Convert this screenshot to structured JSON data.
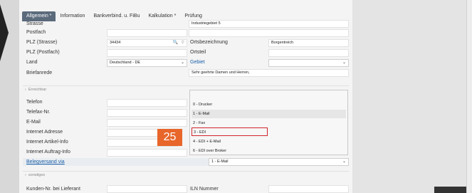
{
  "tabs": [
    "Allgemein *",
    "Information",
    "Bankverbind. u. FiBu",
    "Kalkulation *",
    "Prüfung"
  ],
  "labels": {
    "strasse": "Strasse",
    "postfach": "Postfach",
    "plz_strasse": "PLZ (Strasse)",
    "plz_postfach": "PLZ (Postfach)",
    "land": "Land",
    "briefanrede": "Briefanrede",
    "ortsbezeichnung": "Ortsbezeichnung",
    "ortsteil": "Ortsteil",
    "gebiet": "Gebiet",
    "telefon": "Telefon",
    "telefax": "Telefax-Nr.",
    "email": "E-Mail",
    "internet_adresse": "Internet Adresse",
    "internet_artikel": "Internet Artikel-Info",
    "internet_auftrag": "Internet Auftrag-Info",
    "belegversand": "Belegversand via",
    "kunden_nr": "Kunden-Nr. bei Lieferant",
    "iln_nummer": "ILN Nummer"
  },
  "values": {
    "strasse": "Industriegebiet 5",
    "plz_strasse": "34434",
    "ortsbezeichnung": "Borgentreich",
    "land": "Deutschland - DE",
    "briefanrede": "Sehr geehrte Damen und Herren,",
    "belegversand": "1 - E-Mail"
  },
  "sections": {
    "erreichbar": "Erreichbar",
    "sonstiges": "sonstiges"
  },
  "dropdown": {
    "options": [
      "0 - Drucker",
      "1 - E-Mail",
      "2 - Fax",
      "3 - EDI",
      "4 - EDI + E-Mail",
      "6 - EDI over Broker"
    ],
    "hovered_index": 1,
    "highlighted_index": 3
  },
  "step_badge": "25",
  "icons": {
    "search": "🔍",
    "pin": "⚲",
    "chevron": "⌄"
  },
  "colors": {
    "active_tab": "#5b6b7c",
    "badge": "#e8662a",
    "highlight_box": "#d0232a",
    "link": "#1a5fa8"
  }
}
